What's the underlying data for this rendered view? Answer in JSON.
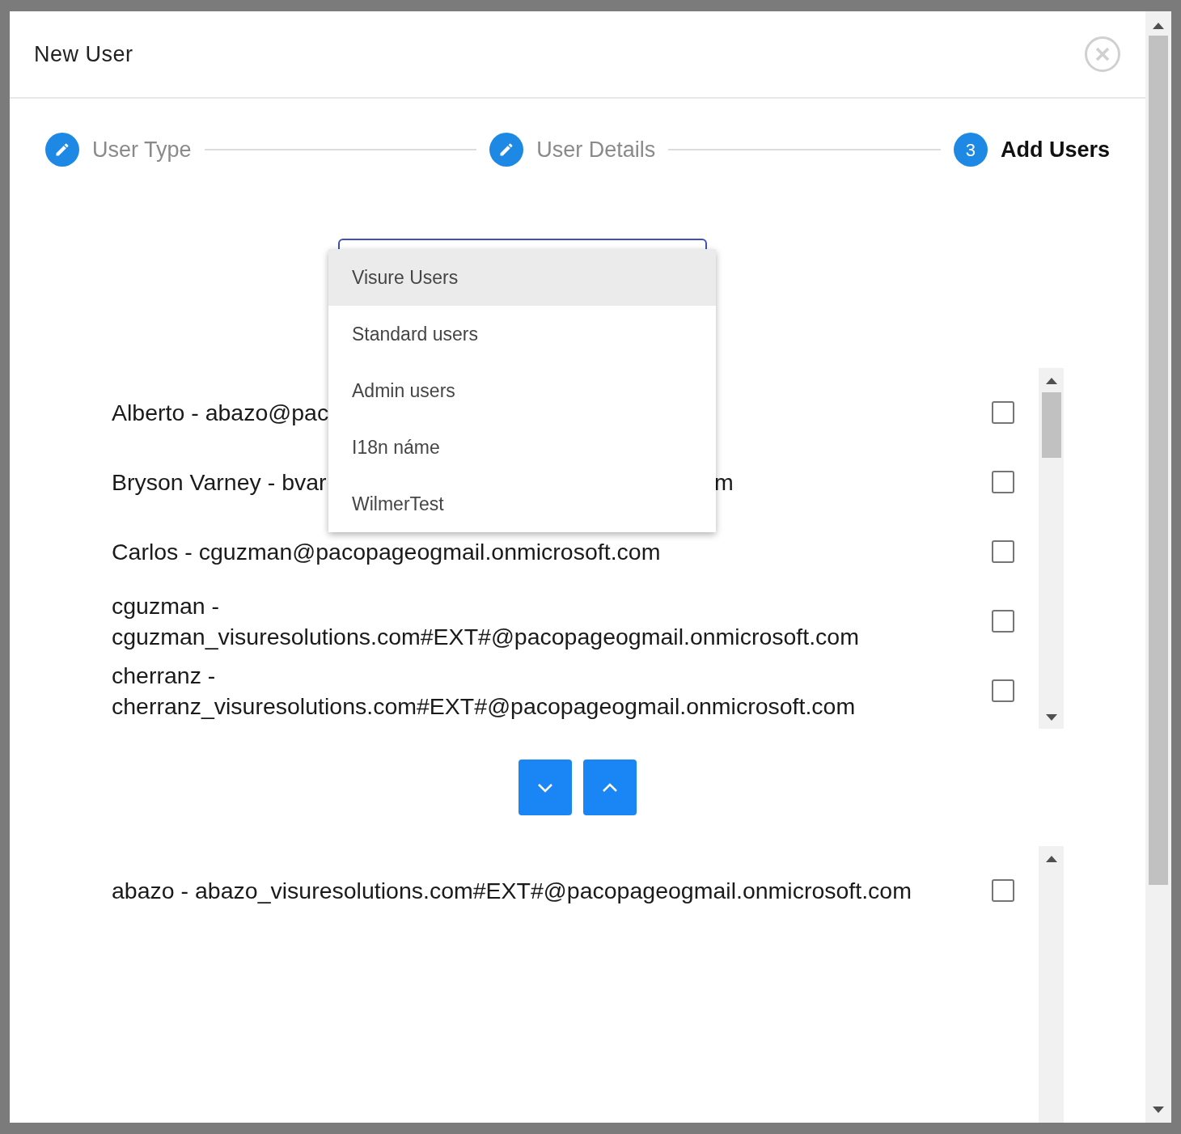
{
  "dialog": {
    "title": "New User"
  },
  "steps": [
    {
      "label": "User Type",
      "kind": "done"
    },
    {
      "label": "User Details",
      "kind": "done"
    },
    {
      "label": "Add Users",
      "kind": "active",
      "number": "3"
    }
  ],
  "group_select": {
    "expanded": true,
    "options": [
      {
        "label": "Visure Users",
        "selected": true
      },
      {
        "label": "Standard users",
        "selected": false
      },
      {
        "label": "Admin users",
        "selected": false
      },
      {
        "label": "I18n náme",
        "selected": false
      },
      {
        "label": "WilmerTest",
        "selected": false
      }
    ]
  },
  "available_users": [
    {
      "text": "Alberto - abazo@pac",
      "checked": false
    },
    {
      "text": "Bryson Varney - bvar",
      "tail": "m",
      "checked": false
    },
    {
      "text": "Carlos - cguzman@pacopageogmail.onmicrosoft.com",
      "checked": false
    },
    {
      "text": "cguzman - cguzman_visuresolutions.com#EXT#@pacopageogmail.onmicrosoft.com",
      "checked": false
    },
    {
      "text": "cherranz - cherranz_visuresolutions.com#EXT#@pacopageogmail.onmicrosoft.com",
      "checked": false
    }
  ],
  "move_buttons": [
    {
      "kind": "down"
    },
    {
      "kind": "up"
    }
  ],
  "selected_users": [
    {
      "text": "abazo - abazo_visuresolutions.com#EXT#@pacopageogmail.onmicrosoft.com",
      "checked": false
    }
  ]
}
